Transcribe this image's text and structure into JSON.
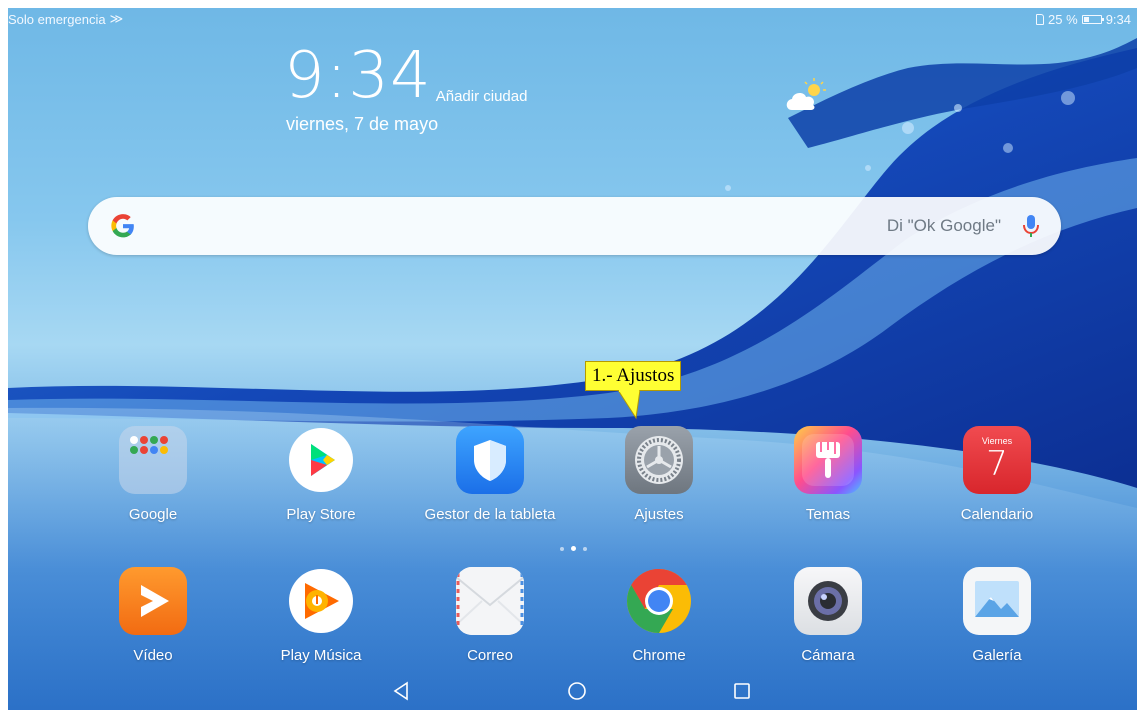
{
  "status_bar": {
    "left_text": "Solo emergencia",
    "battery_text": "25 %",
    "time": "9:34"
  },
  "clock_widget": {
    "time": "9:34",
    "add_city": "Añadir ciudad",
    "date": "viernes, 7 de mayo"
  },
  "weather": {
    "icon": "cloud-sun-icon"
  },
  "search": {
    "hint": "Di \"Ok Google\"",
    "icon": "google-g-icon",
    "mic_icon": "mic-icon"
  },
  "annotation": {
    "text": "1.- Ajustos"
  },
  "home_row": [
    {
      "label": "Google",
      "icon": "google-folder-icon"
    },
    {
      "label": "Play Store",
      "icon": "play-store-icon"
    },
    {
      "label": "Gestor de la tableta",
      "icon": "shield-icon"
    },
    {
      "label": "Ajustes",
      "icon": "gear-icon"
    },
    {
      "label": "Temas",
      "icon": "brush-icon"
    },
    {
      "label": "Calendario",
      "icon": "calendar-icon",
      "day_name": "Viernes",
      "day_number": "7"
    }
  ],
  "dock": [
    {
      "label": "Vídeo",
      "icon": "video-icon"
    },
    {
      "label": "Play Música",
      "icon": "music-icon"
    },
    {
      "label": "Correo",
      "icon": "mail-icon"
    },
    {
      "label": "Chrome",
      "icon": "chrome-icon"
    },
    {
      "label": "Cámara",
      "icon": "camera-icon"
    },
    {
      "label": "Galería",
      "icon": "gallery-icon"
    }
  ],
  "page_indicator": {
    "pages": 3,
    "current": 2
  },
  "nav_bar": [
    "back-icon",
    "home-icon",
    "recents-icon"
  ],
  "colors": {
    "tooltip": "#ffff33",
    "settings_icon": "#7d858f",
    "calendar_icon": "#e8383d",
    "video_icon": "#f5821f"
  }
}
